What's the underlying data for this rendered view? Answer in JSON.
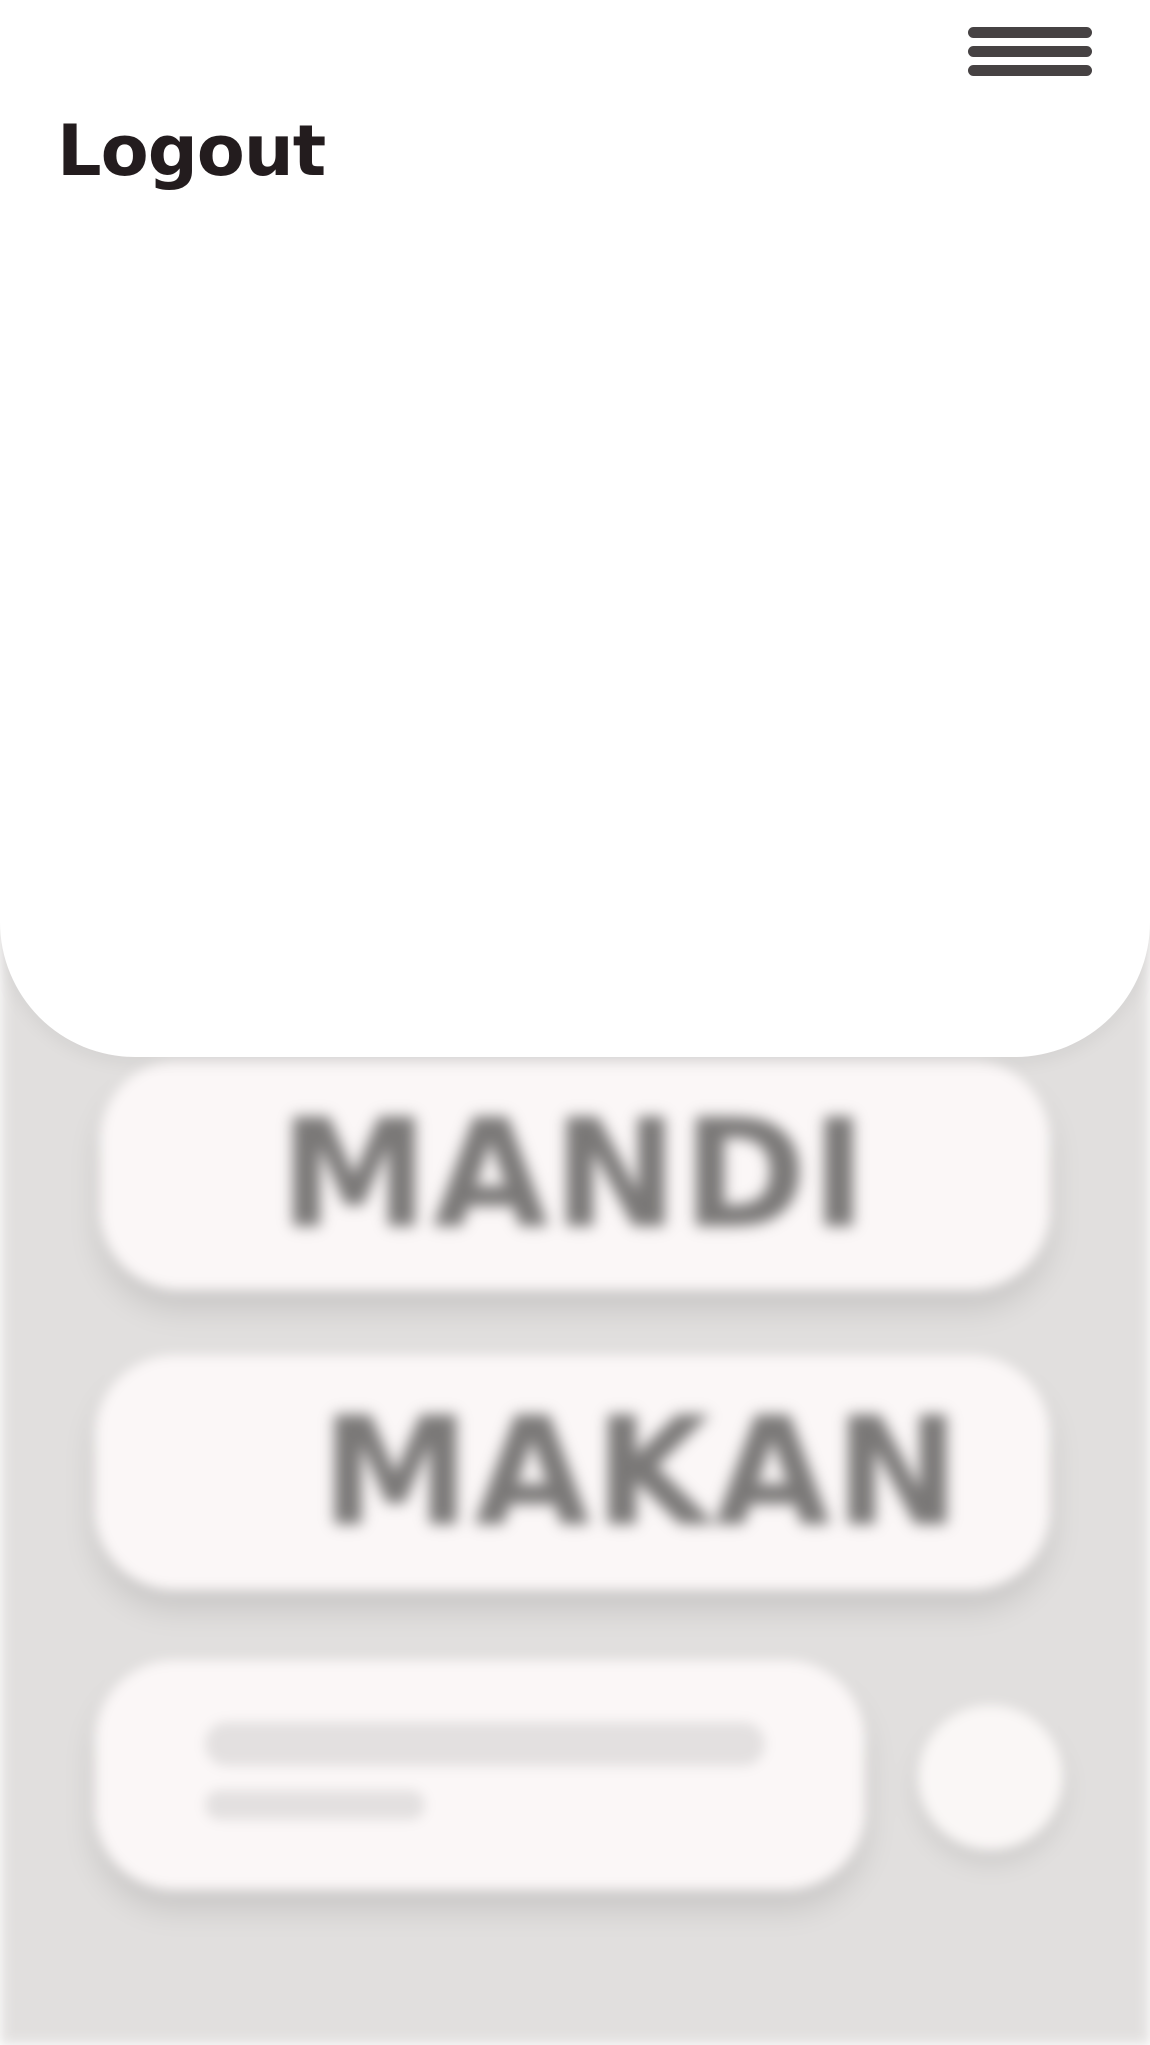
{
  "menu": {
    "logout_label": "Logout"
  },
  "actions": [
    {
      "label": "MANDI"
    },
    {
      "label": "MAKAN"
    }
  ],
  "icons": {
    "menu": "hamburger-menu-icon"
  }
}
